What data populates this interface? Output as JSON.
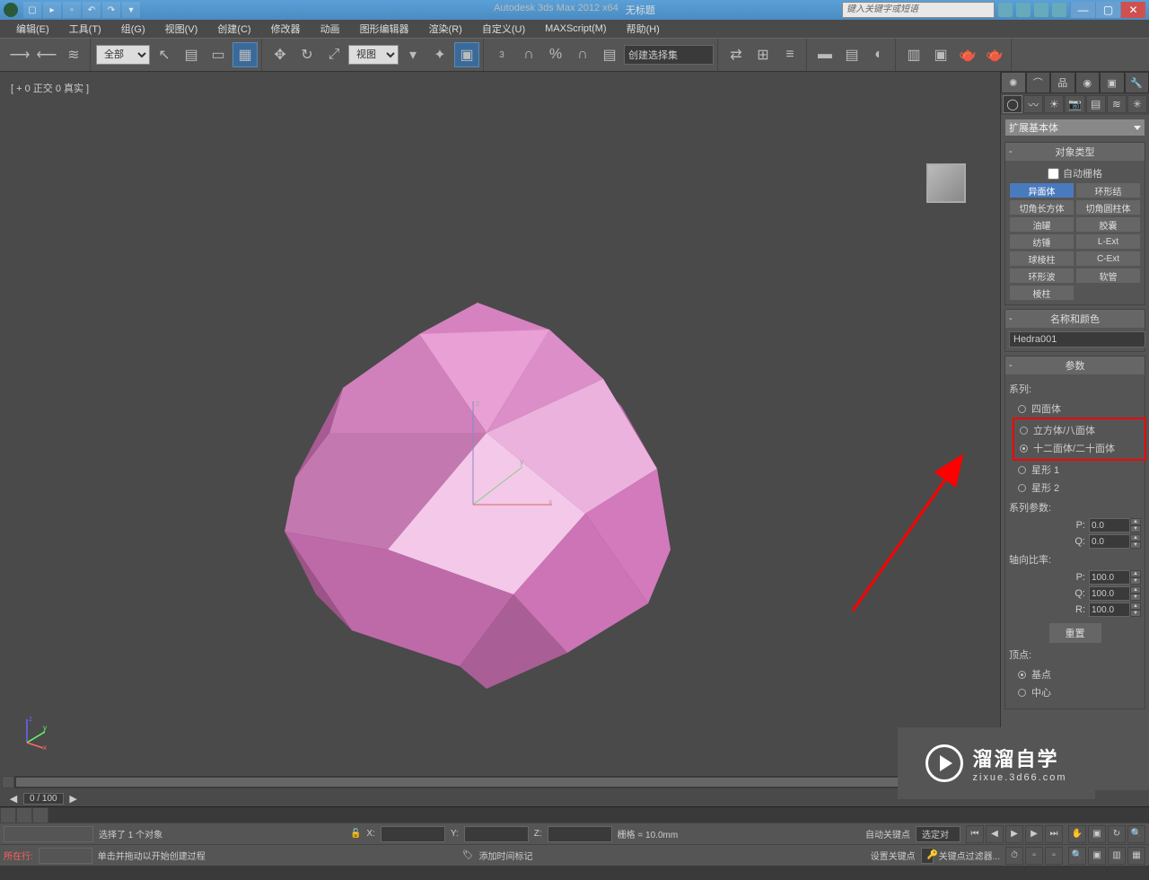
{
  "title": {
    "app": "Autodesk 3ds Max  2012 x64",
    "doc": "无标题"
  },
  "search_placeholder": "键入关键字或短语",
  "menus": [
    "编辑(E)",
    "工具(T)",
    "组(G)",
    "视图(V)",
    "创建(C)",
    "修改器",
    "动画",
    "图形编辑器",
    "渲染(R)",
    "自定义(U)",
    "MAXScript(M)",
    "帮助(H)"
  ],
  "toolbar": {
    "filter": "全部",
    "viewport_sel": "视图",
    "create_set": "创建选择集"
  },
  "viewport_label": "[ + 0 正交 0 真实 ]",
  "command_panel": {
    "category": "扩展基本体",
    "rollouts": {
      "object_type": {
        "title": "对象类型",
        "autogrid": "自动栅格"
      },
      "name_color": {
        "title": "名称和颜色"
      },
      "params": {
        "title": "参数"
      }
    },
    "object_buttons": [
      {
        "l": "异面体",
        "r": "环形结"
      },
      {
        "l": "切角长方体",
        "r": "切角圆柱体"
      },
      {
        "l": "油罐",
        "r": "胶囊"
      },
      {
        "l": "纺锤",
        "r": "L-Ext"
      },
      {
        "l": "球棱柱",
        "r": "C-Ext"
      },
      {
        "l": "环形波",
        "r": "软管"
      },
      {
        "l": "棱柱",
        "r": ""
      }
    ],
    "object_name": "Hedra001",
    "params": {
      "family_label": "系列:",
      "family_options": [
        "四面体",
        "立方体/八面体",
        "十二面体/二十面体",
        "星形 1",
        "星形 2"
      ],
      "family_selected": 2,
      "family_params_label": "系列参数:",
      "p_label": "P:",
      "p_val": "0.0",
      "q_label": "Q:",
      "q_val": "0.0",
      "axis_ratio_label": "轴向比率:",
      "ap": "100.0",
      "aq": "100.0",
      "ar": "100.0",
      "ap_label": "P:",
      "aq_label": "Q:",
      "ar_label": "R:",
      "reset": "重置",
      "vertex_label": "顶点:",
      "vertex_options": [
        "基点",
        "中心"
      ]
    }
  },
  "timeline": {
    "frame": "0 / 100"
  },
  "status": {
    "selected": "选择了 1 个对象",
    "hint": "单击并拖动以开始创建过程",
    "x": "X:",
    "y": "Y:",
    "z": "Z:",
    "grid": "栅格 = 10.0mm",
    "add_marker": "添加时间标记",
    "autokey": "自动关键点",
    "setkey": "设置关键点",
    "selected_obj": "选定对",
    "key_filter": "关键点过滤器...",
    "row_label": "所在行:"
  },
  "watermark": {
    "big": "溜溜自学",
    "small": "zixue.3d66.com"
  }
}
